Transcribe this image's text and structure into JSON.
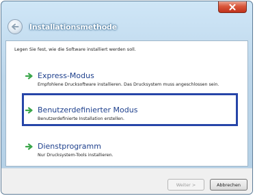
{
  "window": {
    "title": "Installationsmethode"
  },
  "instruction": "Legen Sie fest, wie die Software installiert werden soll.",
  "options": [
    {
      "title": "Express-Modus",
      "description": "Empfohlene Drucksoftware installieren. Das Drucksystem muss angeschlossen sein."
    },
    {
      "title": "Benutzerdefinierter Modus",
      "description": "Benutzerdefinierte Installation erstellen."
    },
    {
      "title": "Dienstprogramm",
      "description": "Nur Drucksystem-Tools installieren."
    }
  ],
  "buttons": {
    "next": "Weiter >",
    "cancel": "Abbrechen"
  },
  "colors": {
    "highlight": "#2645a8",
    "arrow": "#3aa64a",
    "option_title": "#1d3f8c",
    "close_button": "#c0321c"
  },
  "icons": {
    "close": "close-icon",
    "back": "back-arrow-icon",
    "option_arrow": "green-arrow-icon"
  }
}
